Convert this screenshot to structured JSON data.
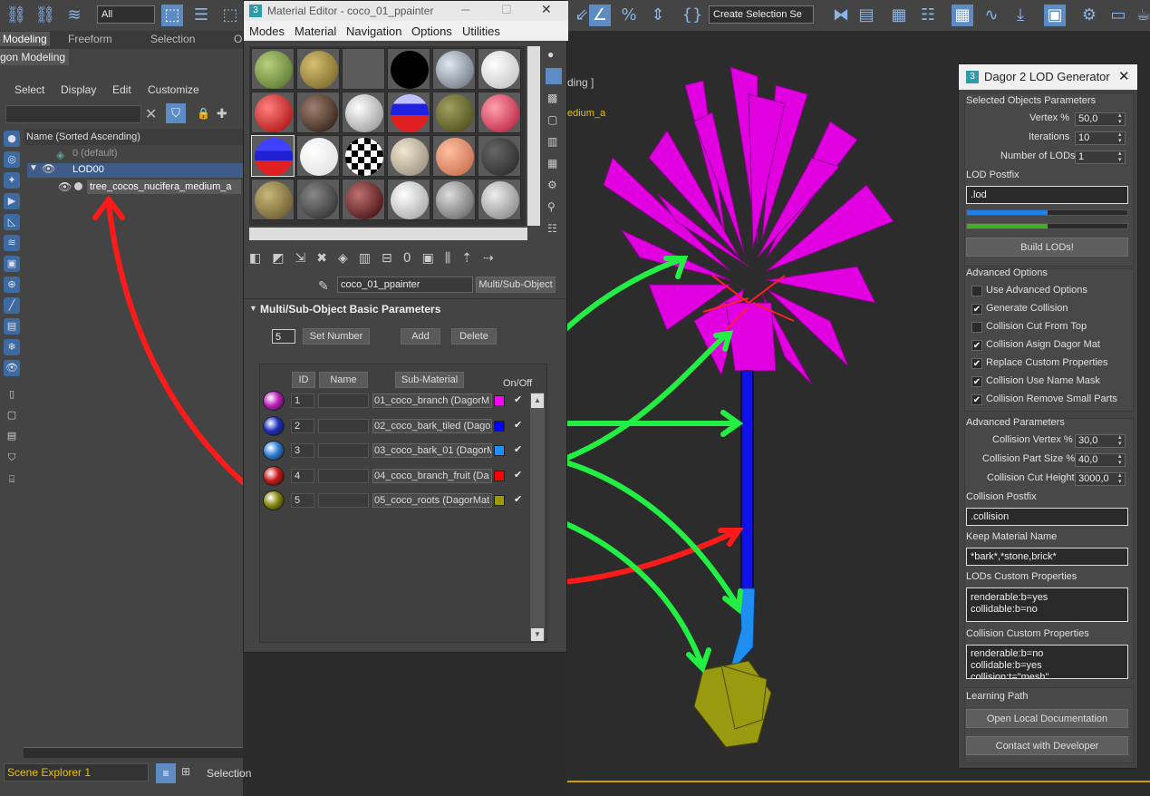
{
  "toolbar": {
    "filter_value": "All",
    "selection_set": "Create Selection Se"
  },
  "ribbon": {
    "tabs": [
      "Modeling",
      "Freeform",
      "Selection",
      "O"
    ],
    "sub": "gon Modeling"
  },
  "scene_explorer": {
    "menu": [
      "Select",
      "Display",
      "Edit",
      "Customize"
    ],
    "column": "Name (Sorted Ascending)",
    "items": [
      "0 (default)",
      "LOD00",
      "tree_cocos_nucifera_medium_a"
    ],
    "bottom_label": "Scene Explorer 1",
    "selection_label": "Selection"
  },
  "material_editor": {
    "title": "Material Editor - coco_01_ppainter",
    "menu": [
      "Modes",
      "Material",
      "Navigation",
      "Options",
      "Utilities"
    ],
    "material_name": "coco_01_ppainter",
    "material_type": "Multi/Sub-Object",
    "rollout": "Multi/Sub-Object Basic Parameters",
    "num": "5",
    "set_number": "Set Number",
    "add": "Add",
    "delete": "Delete",
    "headers": {
      "id": "ID",
      "name": "Name",
      "sub": "Sub-Material",
      "onoff": "On/Off"
    },
    "rows": [
      {
        "id": "1",
        "sub": "01_coco_branch  (DagorM",
        "color": "#ff00ff",
        "ball": "#c020c0"
      },
      {
        "id": "2",
        "sub": "02_coco_bark_tiled  (Dago",
        "color": "#0000ff",
        "ball": "#1c2fbf"
      },
      {
        "id": "3",
        "sub": "03_coco_bark_01  (DagorM",
        "color": "#1e90ff",
        "ball": "#2e7fd8"
      },
      {
        "id": "4",
        "sub": "04_coco_branch_fruit  (Da",
        "color": "#ff0000",
        "ball": "#c81818"
      },
      {
        "id": "5",
        "sub": "05_coco_roots  (DagorMat",
        "color": "#9a9a00",
        "ball": "#8a8a10"
      }
    ]
  },
  "viewport": {
    "label1": "ding ]",
    "label2": "edium_a"
  },
  "lod": {
    "title": "Dagor 2 LOD Generator",
    "sel_params": "Selected Objects Parameters",
    "vertex_label": "Vertex %",
    "vertex": "50,0",
    "iter_label": "Iterations",
    "iter": "10",
    "nlods_label": "Number of LODs",
    "nlods": "1",
    "postfix_label": "LOD Postfix",
    "postfix": ".lod",
    "progress1": 0.5,
    "progress2": 0.5,
    "build": "Build LODs!",
    "adv_opts": "Advanced Options",
    "options": [
      {
        "label": "Use Advanced Options",
        "checked": false
      },
      {
        "label": "Generate Collision",
        "checked": true
      },
      {
        "label": "Collision Cut From Top",
        "checked": false
      },
      {
        "label": "Collision Asign Dagor Mat",
        "checked": true
      },
      {
        "label": "Replace Custom Properties",
        "checked": true
      },
      {
        "label": "Collision Use Name Mask",
        "checked": true
      },
      {
        "label": "Collision Remove Small Parts",
        "checked": true
      }
    ],
    "adv_params": "Advanced Parameters",
    "cv_label": "Collision Vertex %",
    "cv": "30,0",
    "cps_label": "Collision Part Size %",
    "cps": "40,0",
    "cch_label": "Collision Cut Height",
    "cch": "3000,0",
    "cpost_label": "Collision Postfix",
    "cpost": ".collision",
    "keep_label": "Keep Material Name",
    "keep": "*bark*,*stone,brick*",
    "lcp_label": "LODs Custom Properties",
    "lcp": "renderable:b=yes\ncollidable:b=no",
    "ccp_label": "Collision Custom Properties",
    "ccp": "renderable:b=no\ncollidable:b=yes\ncollision:t=\"mesh\"",
    "learn": "Learning Path",
    "doc": "Open Local Documentation",
    "contact": "Contact with Developer"
  }
}
